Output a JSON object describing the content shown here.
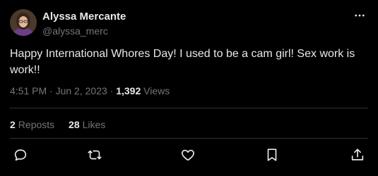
{
  "author": {
    "name": "Alyssa Mercante",
    "handle": "@alyssa_merc"
  },
  "tweet": {
    "text": "Happy International Whores Day! I used to be a cam girl! Sex work is work!!",
    "time": "4:51 PM",
    "date": "Jun 2, 2023",
    "separator": "·",
    "views_count": "1,392",
    "views_label": "Views"
  },
  "stats": {
    "reposts_count": "2",
    "reposts_label": "Reposts",
    "likes_count": "28",
    "likes_label": "Likes"
  },
  "icons": {
    "more": "more-horizontal-icon",
    "reply": "reply-icon",
    "repost": "repost-icon",
    "like": "heart-icon",
    "bookmark": "bookmark-icon",
    "share": "share-icon"
  },
  "colors": {
    "background": "#000000",
    "text_primary": "#e7e9ea",
    "text_secondary": "#71767b",
    "divider": "#2f3336"
  }
}
